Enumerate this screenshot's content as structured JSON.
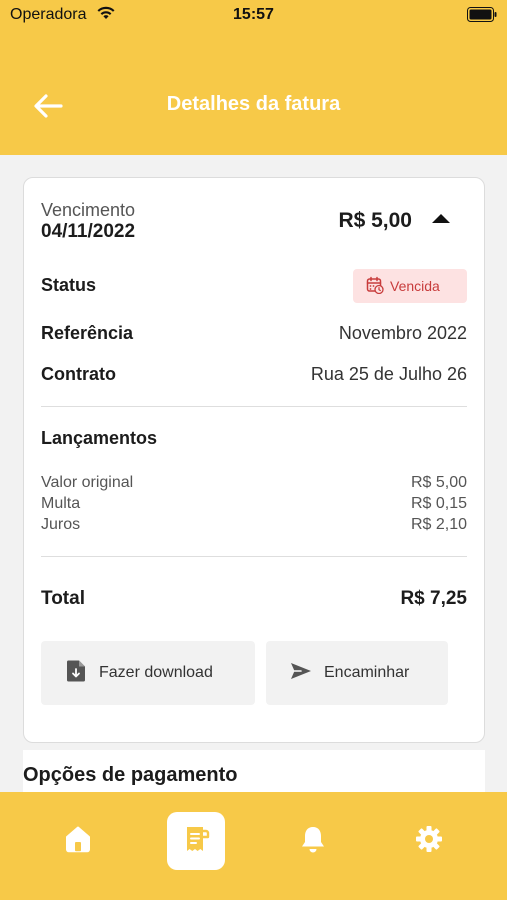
{
  "status_bar": {
    "carrier": "Operadora",
    "time": "15:57"
  },
  "header": {
    "title": "Detalhes da fatura"
  },
  "invoice": {
    "due_label": "Vencimento",
    "due_date": "04/11/2022",
    "amount": "R$ 5,00",
    "status_label": "Status",
    "status_value": "Vencida",
    "reference_label": "Referência",
    "reference_value": "Novembro 2022",
    "contract_label": "Contrato",
    "contract_value": "Rua 25 de Julho 26"
  },
  "entries": {
    "title": "Lançamentos",
    "items": [
      {
        "label": "Valor original",
        "value": "R$ 5,00"
      },
      {
        "label": "Multa",
        "value": "R$ 0,15"
      },
      {
        "label": "Juros",
        "value": "R$ 2,10"
      }
    ]
  },
  "total": {
    "label": "Total",
    "value": "R$ 7,25"
  },
  "actions": {
    "download_label": "Fazer download",
    "forward_label": "Encaminhar"
  },
  "payment": {
    "title": "Opções de pagamento"
  },
  "tabs": [
    {
      "icon": "home-icon"
    },
    {
      "icon": "invoice-icon",
      "active": true
    },
    {
      "icon": "bell-icon"
    },
    {
      "icon": "gear-icon"
    }
  ],
  "colors": {
    "accent": "#f7c948",
    "status_bg": "#fde2e2",
    "status_text": "#c83c3c"
  }
}
